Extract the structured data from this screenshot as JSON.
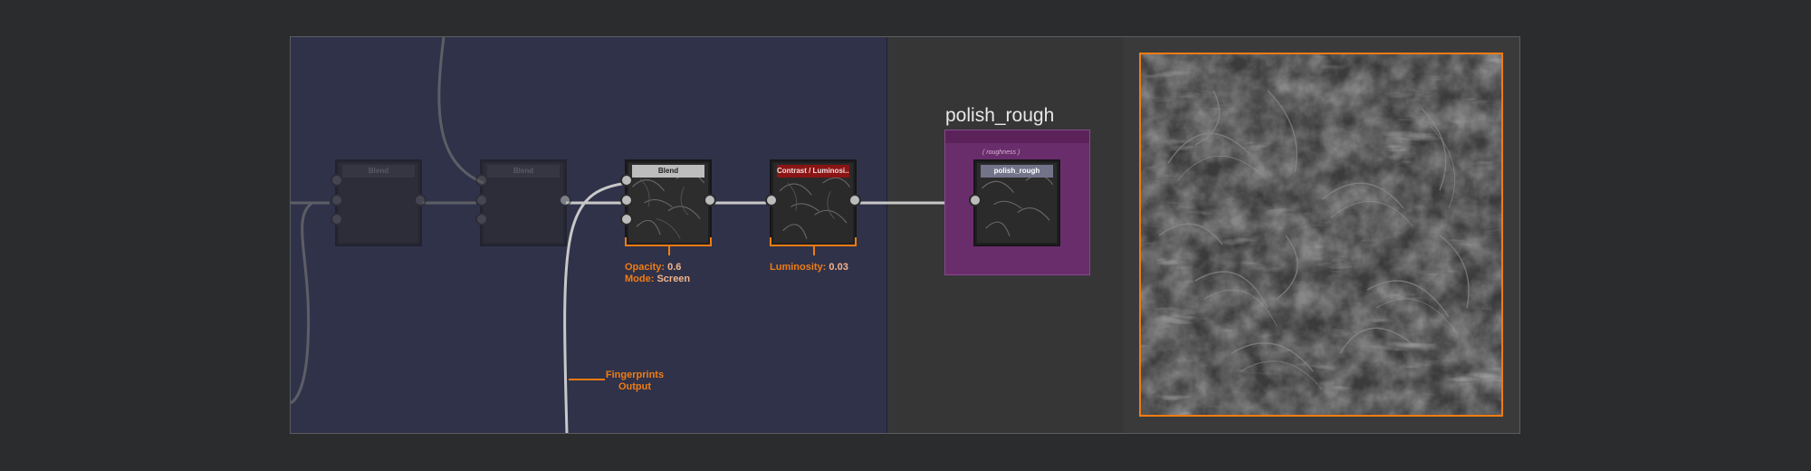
{
  "graph": {
    "nodes": [
      {
        "id": "blend-a",
        "title": "Blend",
        "state": "dimmed"
      },
      {
        "id": "blend-b",
        "title": "Blend",
        "state": "dimmed"
      },
      {
        "id": "blend-c",
        "title": "Blend",
        "state": "active"
      },
      {
        "id": "contrast",
        "title": "Contrast / Luminosi...",
        "state": "active"
      },
      {
        "id": "output",
        "title": "polish_rough",
        "state": "active"
      }
    ],
    "annotations": {
      "blend": {
        "opacity_label": "Opacity:",
        "opacity_value": "0.6",
        "mode_label": "Mode:",
        "mode_value": "Screen"
      },
      "contrast": {
        "luminosity_label": "Luminosity:",
        "luminosity_value": "0.03"
      },
      "fingerprints": {
        "line1": "Fingerprints",
        "line2": "Output"
      }
    }
  },
  "output_frame": {
    "title": "polish_rough",
    "group_label": "( roughness )",
    "color": "#6a2d6c"
  },
  "colors": {
    "accent": "#f07c12",
    "graph_bg": "#30324a",
    "contrast_title": "#8b1414"
  },
  "preview": {
    "description_icon": "roughness-texture-preview"
  }
}
